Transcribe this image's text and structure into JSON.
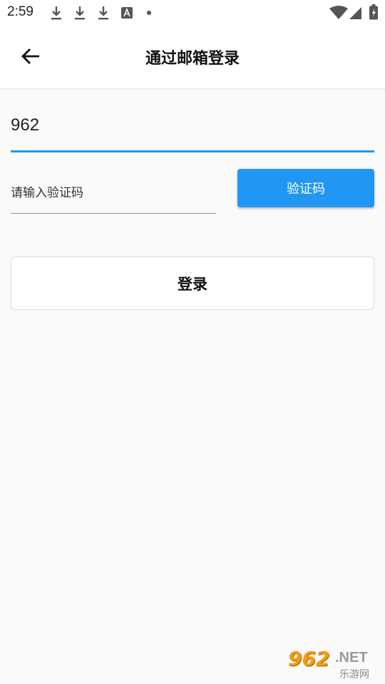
{
  "status_bar": {
    "time": "2:59",
    "icons": [
      "download-icon",
      "download-icon",
      "download-icon",
      "text-a-icon",
      "dot-icon",
      "wifi-icon",
      "signal-icon",
      "battery-icon"
    ]
  },
  "appbar": {
    "title": "通过邮箱登录",
    "back_icon": "arrow-left-icon"
  },
  "form": {
    "email_value": "962",
    "code_placeholder": "请输入验证码",
    "code_button_label": "验证码",
    "login_button_label": "登录"
  },
  "watermark": {
    "main": "962",
    "suffix": ".NET",
    "sub": "乐游网"
  },
  "colors": {
    "accent": "#2196f3",
    "background": "#fafafa",
    "watermark_orange": "#f39c12"
  }
}
